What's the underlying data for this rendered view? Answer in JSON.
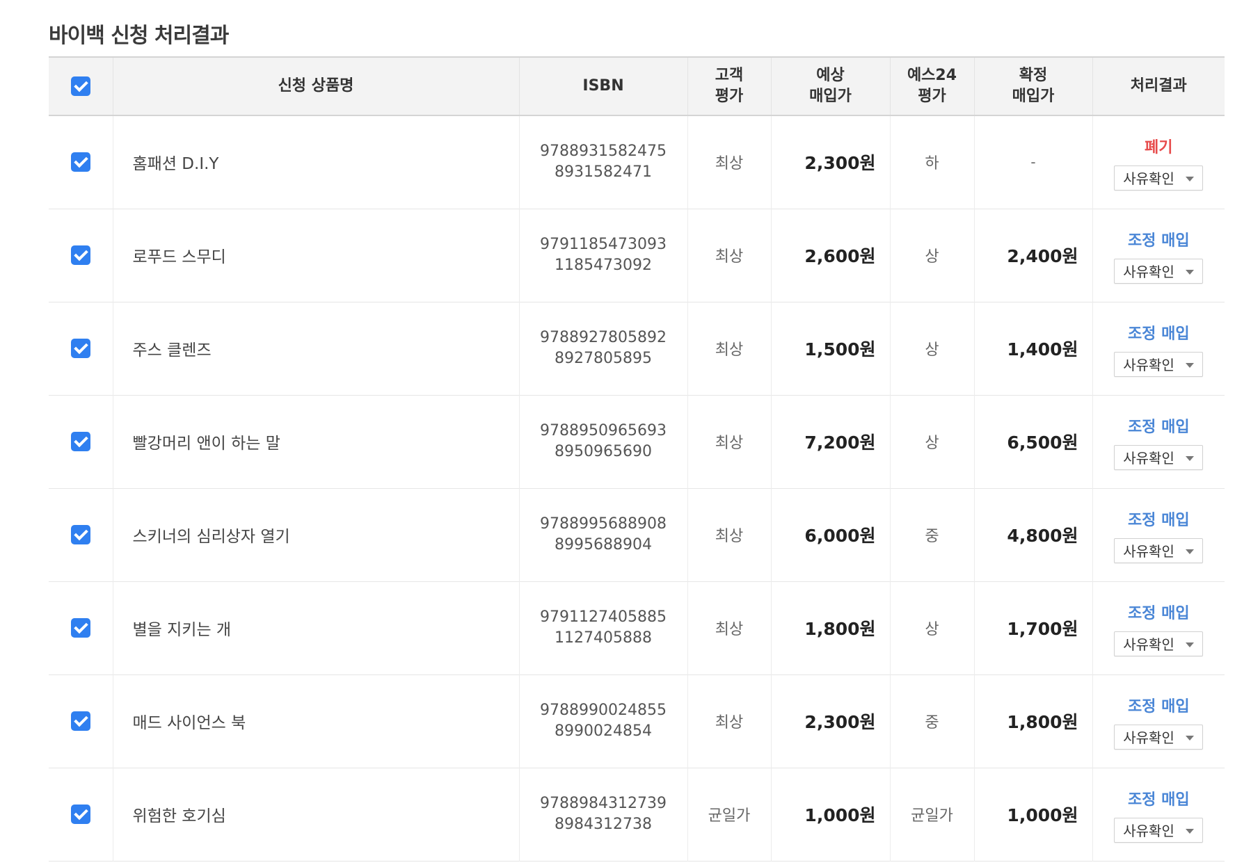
{
  "page": {
    "title": "바이백 신청 처리결과"
  },
  "colors": {
    "checkbox": "#2f7ff0",
    "discard": "#e74c4c",
    "adjust": "#4a86d6"
  },
  "header": {
    "product_name": "신청 상품명",
    "isbn": "ISBN",
    "customer_grade_1": "고객",
    "customer_grade_2": "평가",
    "expected_price_1": "예상",
    "expected_price_2": "매입가",
    "yes24_grade_1": "예스24",
    "yes24_grade_2": "평가",
    "confirmed_price_1": "확정",
    "confirmed_price_2": "매입가",
    "result": "처리결과"
  },
  "rows": [
    {
      "name": "홈패션 D.I.Y",
      "isbn13": "9788931582475",
      "isbn10": "8931582471",
      "customer_grade": "최상",
      "expected_price": "2,300원",
      "yes24_grade": "하",
      "confirmed_price": "-",
      "status": "폐기",
      "reason_label": "사유확인"
    },
    {
      "name": "로푸드 스무디",
      "isbn13": "9791185473093",
      "isbn10": "1185473092",
      "customer_grade": "최상",
      "expected_price": "2,600원",
      "yes24_grade": "상",
      "confirmed_price": "2,400원",
      "status": "조정 매입",
      "reason_label": "사유확인"
    },
    {
      "name": "주스 클렌즈",
      "isbn13": "9788927805892",
      "isbn10": "8927805895",
      "customer_grade": "최상",
      "expected_price": "1,500원",
      "yes24_grade": "상",
      "confirmed_price": "1,400원",
      "status": "조정 매입",
      "reason_label": "사유확인"
    },
    {
      "name": "빨강머리 앤이 하는 말",
      "isbn13": "9788950965693",
      "isbn10": "8950965690",
      "customer_grade": "최상",
      "expected_price": "7,200원",
      "yes24_grade": "상",
      "confirmed_price": "6,500원",
      "status": "조정 매입",
      "reason_label": "사유확인"
    },
    {
      "name": "스키너의 심리상자 열기",
      "isbn13": "9788995688908",
      "isbn10": "8995688904",
      "customer_grade": "최상",
      "expected_price": "6,000원",
      "yes24_grade": "중",
      "confirmed_price": "4,800원",
      "status": "조정 매입",
      "reason_label": "사유확인"
    },
    {
      "name": "별을 지키는 개",
      "isbn13": "9791127405885",
      "isbn10": "1127405888",
      "customer_grade": "최상",
      "expected_price": "1,800원",
      "yes24_grade": "상",
      "confirmed_price": "1,700원",
      "status": "조정 매입",
      "reason_label": "사유확인"
    },
    {
      "name": "매드 사이언스 북",
      "isbn13": "9788990024855",
      "isbn10": "8990024854",
      "customer_grade": "최상",
      "expected_price": "2,300원",
      "yes24_grade": "중",
      "confirmed_price": "1,800원",
      "status": "조정 매입",
      "reason_label": "사유확인"
    },
    {
      "name": "위험한 호기심",
      "isbn13": "9788984312739",
      "isbn10": "8984312738",
      "customer_grade": "균일가",
      "expected_price": "1,000원",
      "yes24_grade": "균일가",
      "confirmed_price": "1,000원",
      "status": "조정 매입",
      "reason_label": "사유확인"
    }
  ]
}
